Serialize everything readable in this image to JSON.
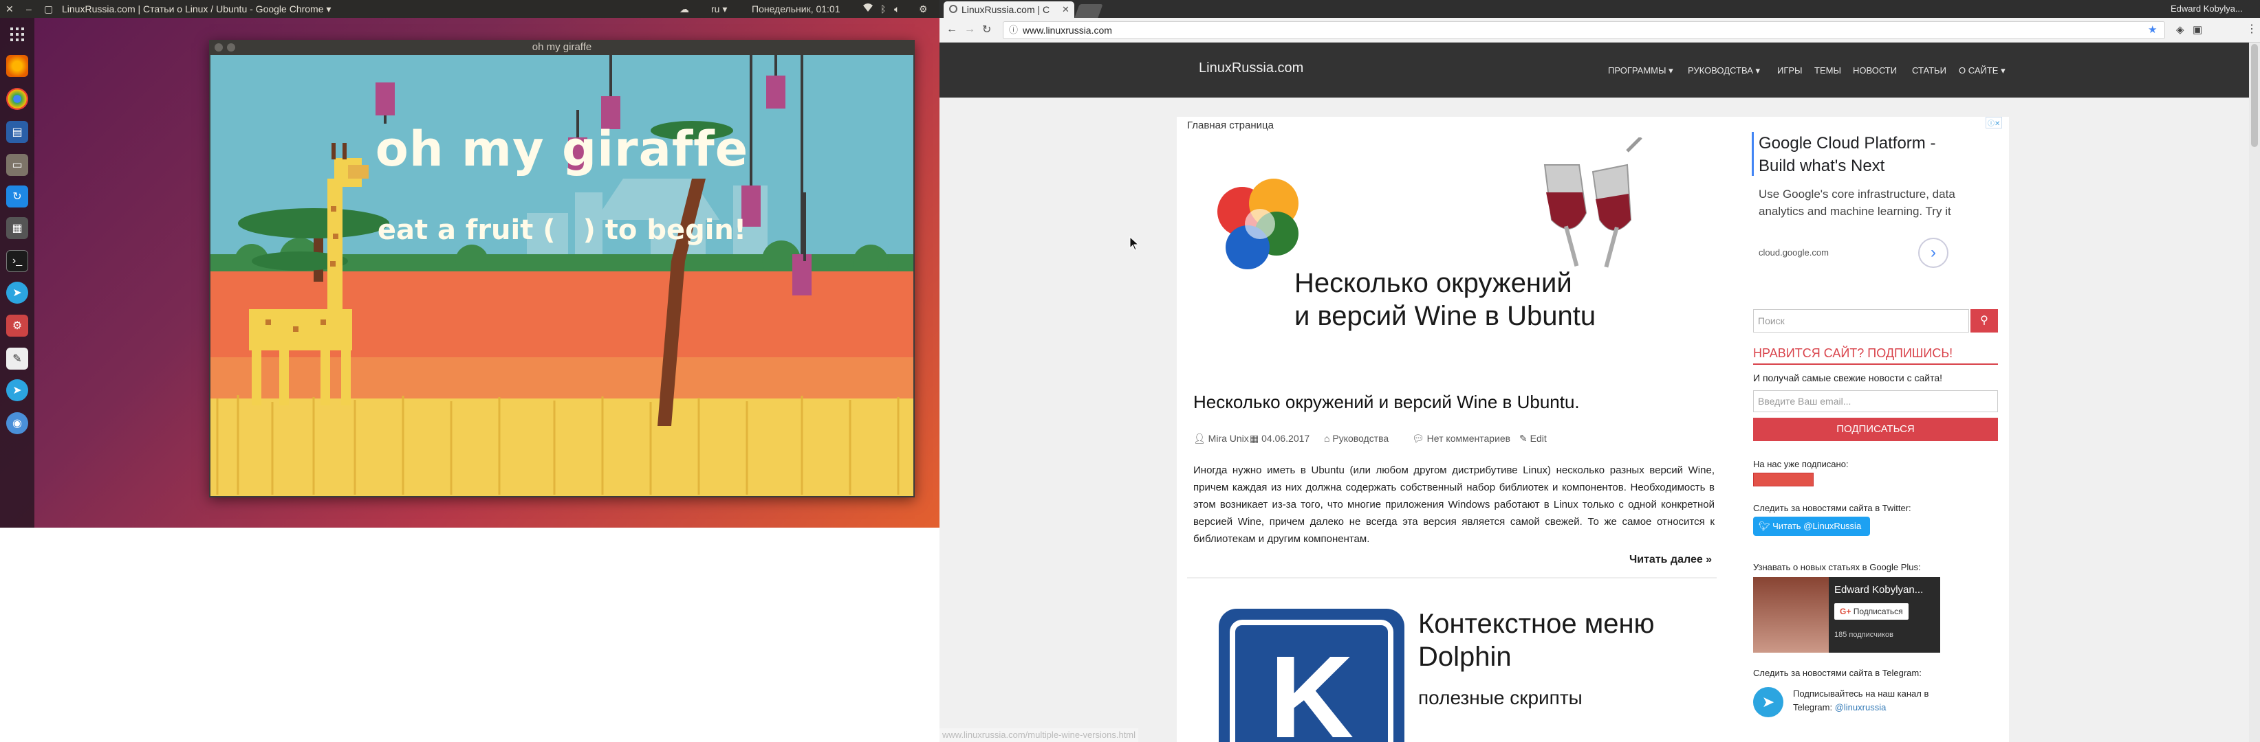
{
  "top_panel": {
    "window_title": "LinuxRussia.com | Статьи о Linux / Ubuntu - Google Chrome ▾",
    "keyboard_layout": "ru ▾",
    "clock": "Понедельник, 01:01"
  },
  "game_window": {
    "title": "oh my giraffe",
    "heading": "oh my giraffe",
    "subheading_pre": "eat a fruit (",
    "subheading_post": ") to begin!"
  },
  "chrome": {
    "tab_title": "LinuxRussia.com | С",
    "url": "www.linuxrussia.com",
    "profile_name": "Edward Kobylya..."
  },
  "site": {
    "logo": "LinuxRussia.com",
    "nav": [
      "ПРОГРАММЫ ▾",
      "РУКОВОДСТВА ▾",
      "ИГРЫ",
      "ТЕМЫ",
      "НОВОСТИ",
      "СТАТЬИ",
      "О САЙТЕ ▾"
    ],
    "breadcrumb": "Главная страница",
    "featured_image": {
      "line1": "Несколько окружений",
      "line2": "и версий Wine в Ubuntu"
    },
    "post": {
      "title": "Несколько окружений и версий Wine в Ubuntu.",
      "author": "Mira Unix",
      "date": "04.06.2017",
      "category": "Руководства",
      "comments": "Нет комментариев",
      "edit": "Edit",
      "excerpt": "Иногда нужно иметь в Ubuntu (или любом другом дистрибутиве Linux) несколько разных версий Wine, причем каждая из них должна содержать собственный набор библиотек и компонентов. Необходимость в этом возникает из-за того, что многие приложения Windows работают в Linux только с одной конкретной версией Wine, причем далеко не всегда эта версия является самой свежей. То же самое относится к библиотекам и другим компонентам.",
      "read_more": "Читать далее »"
    },
    "second_post_image": {
      "line1": "Контекстное меню",
      "line2": "Dolphin",
      "line3": "полезные скрипты"
    },
    "status_url": "www.linuxrussia.com/multiple-wine-versions.html",
    "ad": {
      "title": "Google Cloud Platform - Build what's Next",
      "body": "Use Google's core infrastructure, data analytics and machine learning. Try it",
      "domain": "cloud.google.com"
    },
    "sidebar": {
      "search_placeholder": "Поиск",
      "subscribe_heading": "НРАВИТСЯ САЙТ? ПОДПИШИСЬ!",
      "subscribe_text": "И получай самые свежие новости с сайта!",
      "email_placeholder": "Введите Ваш email...",
      "subscribe_button": "ПОДПИСАТЬСЯ",
      "subscribed_label": "На нас уже подписано:",
      "twitter_label": "Следить за новостями сайта в Twitter:",
      "twitter_button": "Читать @LinuxRussia",
      "gplus_label": "Узнавать о новых статьях в Google Plus:",
      "gplus_name": "Edward Kobylyan...",
      "gplus_follow": "Подписаться",
      "gplus_followers": "185 подписчиков",
      "telegram_label": "Следить за новостями сайта в Telegram:",
      "telegram_text": "Подписывайтесь на наш канал в",
      "telegram_text2": "Telegram:",
      "telegram_link": "@linuxrussia"
    }
  },
  "colors": {
    "site_accent": "#d9434b",
    "nav_bg": "#333333",
    "twitter_blue": "#1da1f2"
  }
}
